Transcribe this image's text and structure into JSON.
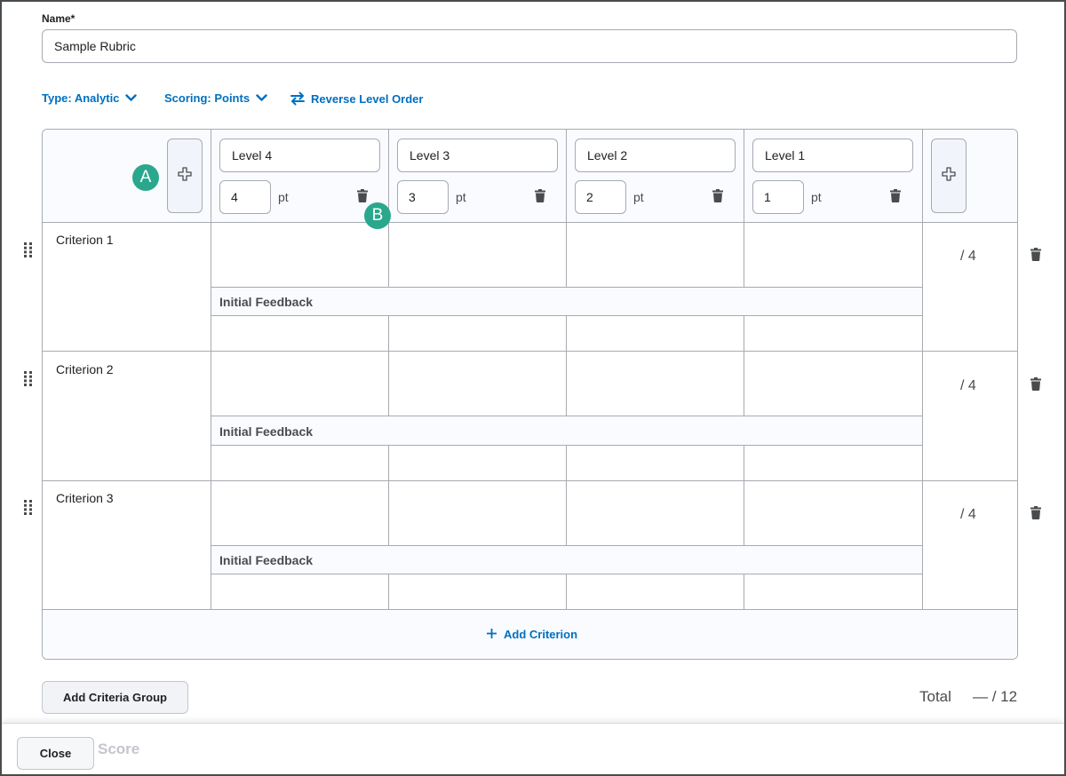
{
  "name_field": {
    "label": "Name*",
    "value": "Sample Rubric"
  },
  "toolbar": {
    "type_label": "Type: Analytic",
    "scoring_label": "Scoring: Points",
    "reverse_label": "Reverse Level Order"
  },
  "levels": [
    {
      "name": "Level 4",
      "points": "4",
      "unit": "pt"
    },
    {
      "name": "Level 3",
      "points": "3",
      "unit": "pt"
    },
    {
      "name": "Level 2",
      "points": "2",
      "unit": "pt"
    },
    {
      "name": "Level 1",
      "points": "1",
      "unit": "pt"
    }
  ],
  "criteria": [
    {
      "name": "Criterion 1",
      "score": "/ 4",
      "feedback_label": "Initial Feedback"
    },
    {
      "name": "Criterion 2",
      "score": "/ 4",
      "feedback_label": "Initial Feedback"
    },
    {
      "name": "Criterion 3",
      "score": "/ 4",
      "feedback_label": "Initial Feedback"
    }
  ],
  "add_criterion_label": "Add Criterion",
  "add_criteria_group_label": "Add Criteria Group",
  "total": {
    "label": "Total",
    "value": "— / 12"
  },
  "footer": {
    "close_label": "Close",
    "ghost_text": "Score"
  },
  "badges": {
    "a": "A",
    "b": "B"
  },
  "colors": {
    "accent": "#006fbf",
    "badge": "#2aa78c",
    "border": "#a7aab1"
  },
  "icons": [
    "chevron-down-icon",
    "swap-arrows-icon",
    "plus-icon",
    "trash-icon",
    "drag-handle-icon"
  ]
}
